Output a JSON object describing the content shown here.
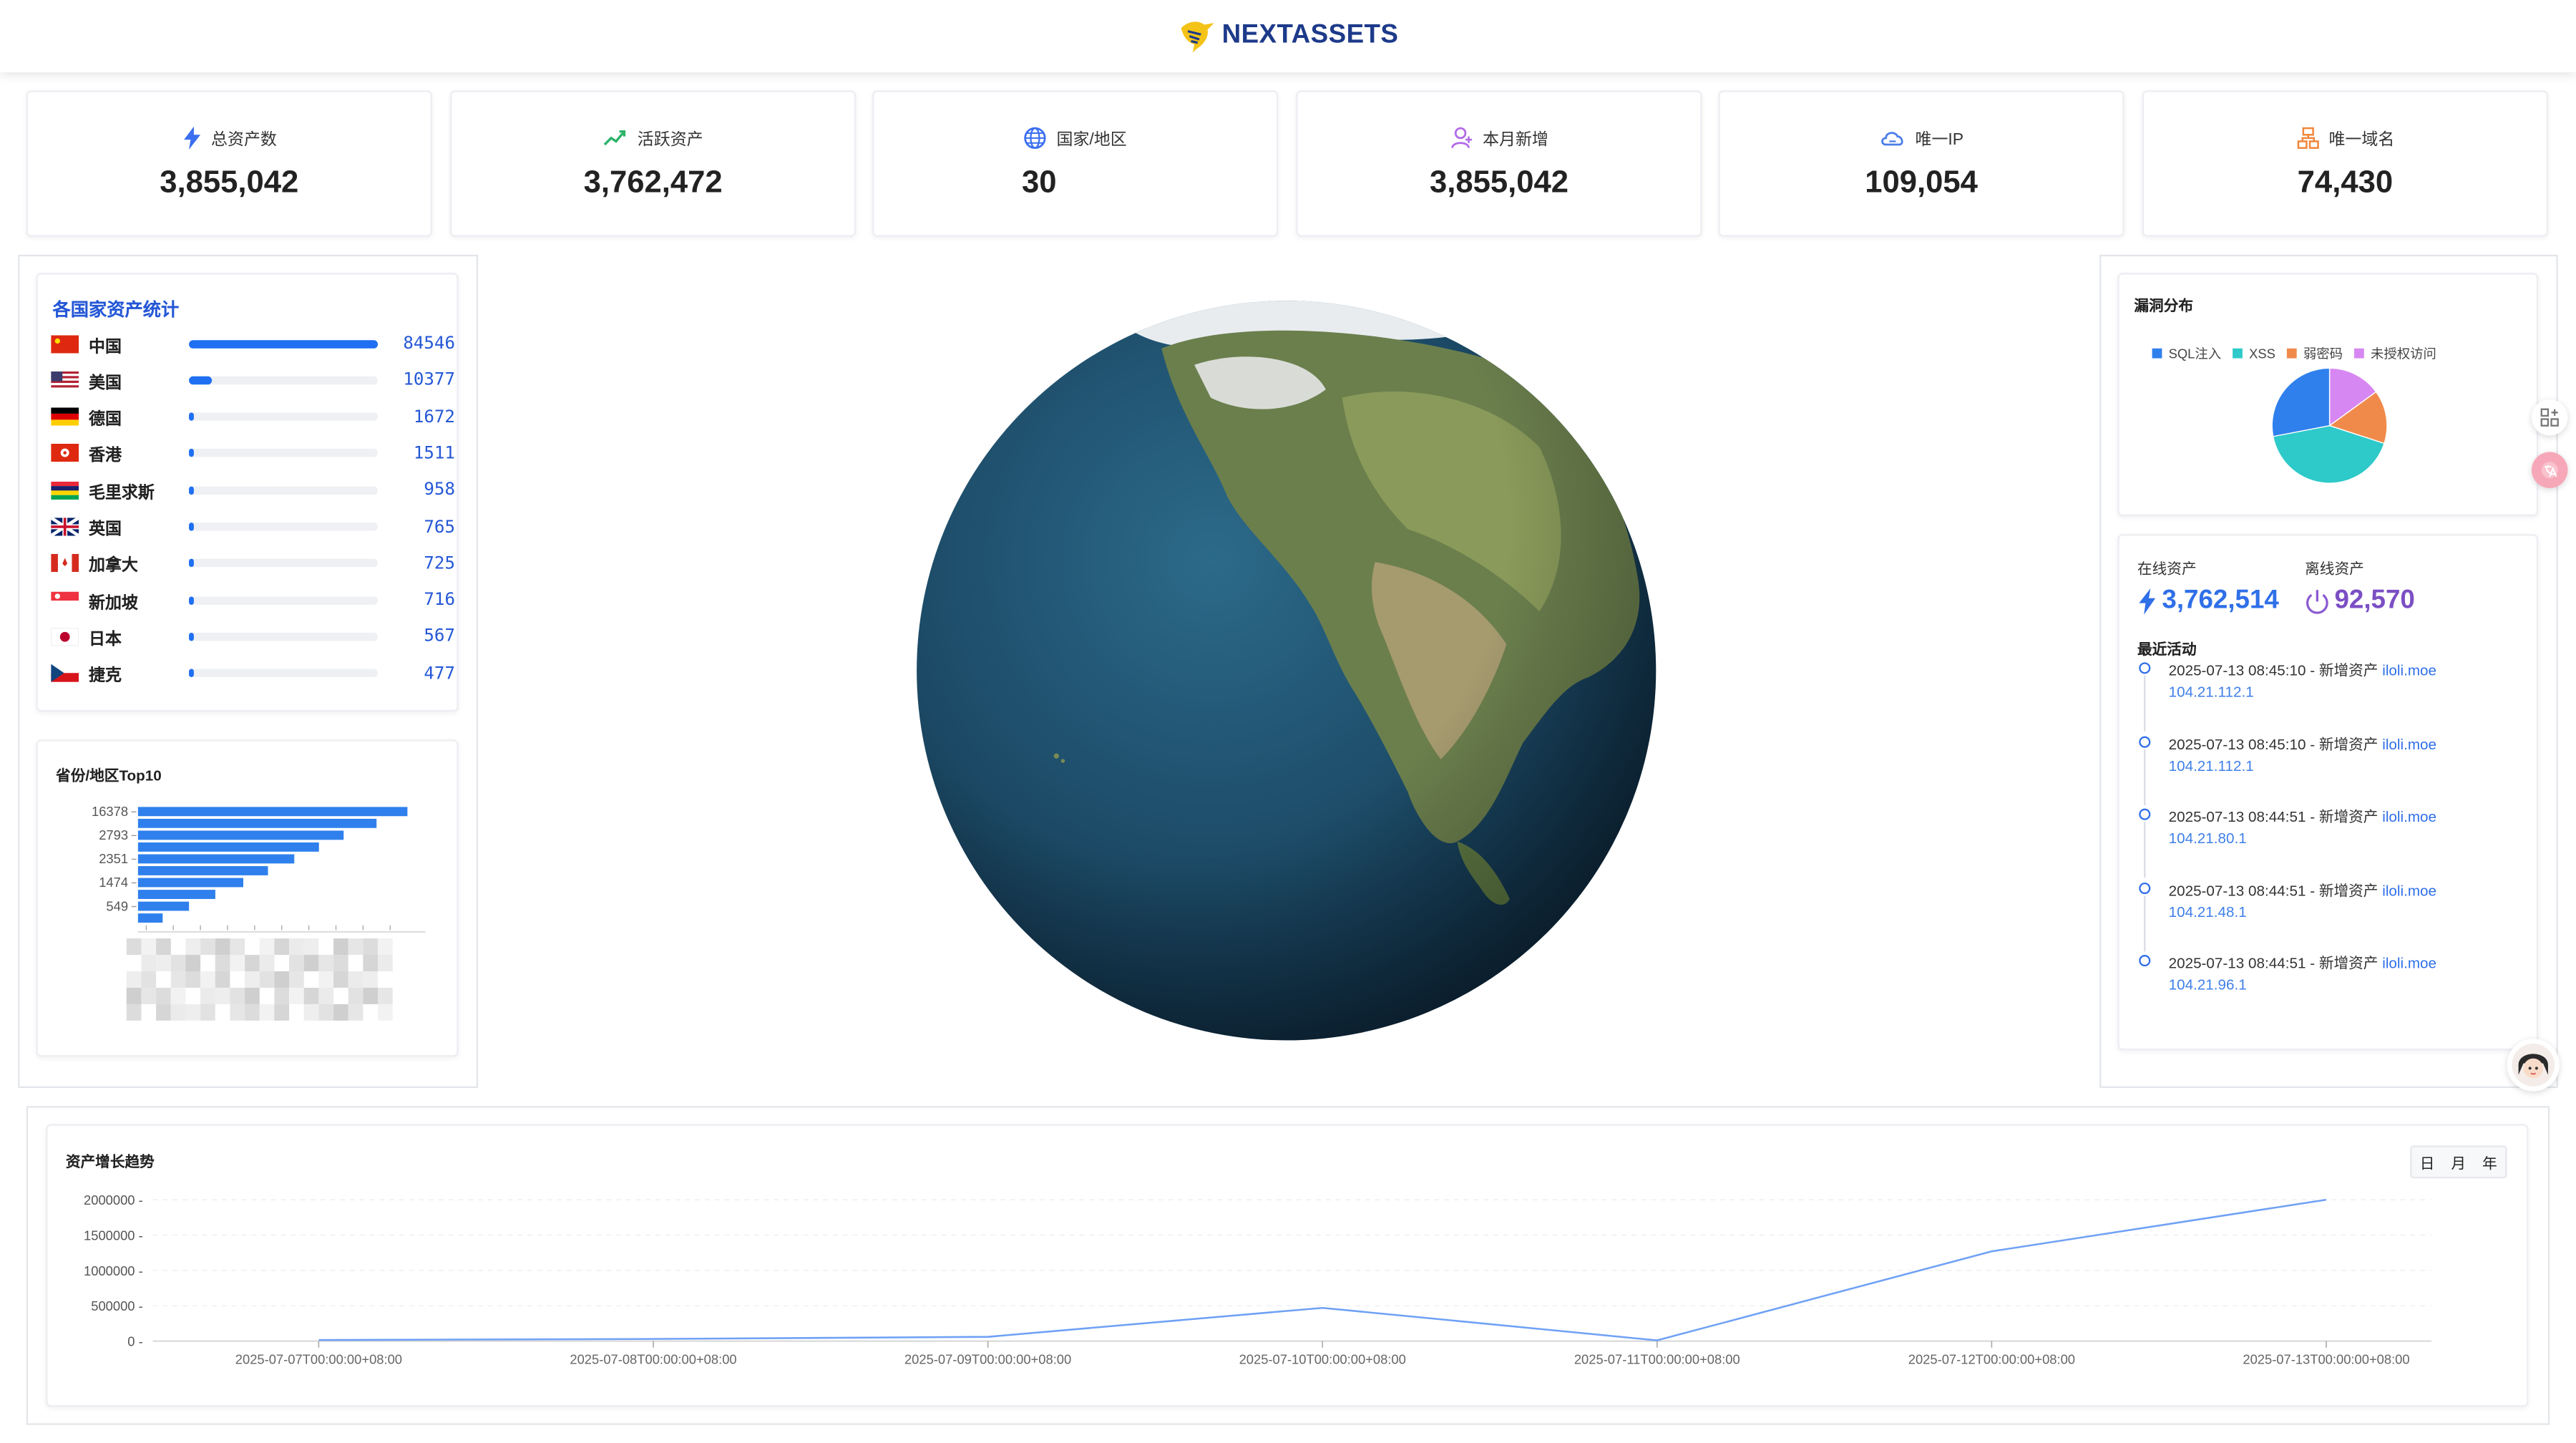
{
  "app": {
    "brand": "NEXTASSETS"
  },
  "stats": [
    {
      "label": "总资产数",
      "value": "3,855,042",
      "icon": "bolt-icon"
    },
    {
      "label": "活跃资产",
      "value": "3,762,472",
      "icon": "trend-up-icon"
    },
    {
      "label": "国家/地区",
      "value": "30",
      "icon": "globe-icon"
    },
    {
      "label": "本月新增",
      "value": "3,855,042",
      "icon": "user-add-icon"
    },
    {
      "label": "唯一IP",
      "value": "109,054",
      "icon": "cloud-icon"
    },
    {
      "label": "唯一域名",
      "value": "74,430",
      "icon": "sitemap-icon"
    }
  ],
  "countries": {
    "title": "各国家资产统计",
    "items": [
      {
        "name": "中国",
        "value": "84546",
        "ratio": 1.0
      },
      {
        "name": "美国",
        "value": "10377",
        "ratio": 0.123
      },
      {
        "name": "德国",
        "value": "1672",
        "ratio": 0.02
      },
      {
        "name": "香港",
        "value": "1511",
        "ratio": 0.018
      },
      {
        "name": "毛里求斯",
        "value": "958",
        "ratio": 0.011
      },
      {
        "name": "英国",
        "value": "765",
        "ratio": 0.009
      },
      {
        "name": "加拿大",
        "value": "725",
        "ratio": 0.009
      },
      {
        "name": "新加坡",
        "value": "716",
        "ratio": 0.008
      },
      {
        "name": "日本",
        "value": "567",
        "ratio": 0.007
      },
      {
        "name": "捷克",
        "value": "477",
        "ratio": 0.006
      }
    ]
  },
  "province": {
    "title": "省份/地区Top10",
    "chart_data": {
      "type": "bar",
      "orientation": "horizontal",
      "tick_labels": [
        "16378",
        "2793",
        "2351",
        "1474",
        "549"
      ],
      "values": [
        16378,
        14500,
        12500,
        11000,
        9500,
        7900,
        6400,
        4700,
        3100,
        1500
      ]
    }
  },
  "vuln": {
    "title": "漏洞分布",
    "chart_data": {
      "type": "pie",
      "legend": [
        "SQL注入",
        "XSS",
        "弱密码",
        "未授权访问"
      ],
      "values": [
        28,
        42,
        15,
        15
      ],
      "colors": [
        "#2f80ed",
        "#2ec9c9",
        "#f08a4b",
        "#d787f2"
      ]
    }
  },
  "status": {
    "online_label": "在线资产",
    "online_value": "3,762,514",
    "offline_label": "离线资产",
    "offline_value": "92,570",
    "activity_title": "最近活动",
    "activities": [
      {
        "text": "2025-07-13 08:45:10 - 新增资产 ",
        "domain": "iloli.moe",
        "ip": "104.21.112.1"
      },
      {
        "text": "2025-07-13 08:45:10 - 新增资产 ",
        "domain": "iloli.moe",
        "ip": "104.21.112.1"
      },
      {
        "text": "2025-07-13 08:44:51 - 新增资产 ",
        "domain": "iloli.moe",
        "ip": "104.21.80.1"
      },
      {
        "text": "2025-07-13 08:44:51 - 新增资产 ",
        "domain": "iloli.moe",
        "ip": "104.21.48.1"
      },
      {
        "text": "2025-07-13 08:44:51 - 新增资产 ",
        "domain": "iloli.moe",
        "ip": "104.21.96.1"
      }
    ]
  },
  "trend": {
    "title": "资产增长趋势",
    "ranges": [
      "日",
      "月",
      "年"
    ],
    "chart_data": {
      "type": "line",
      "x": [
        "2025-07-07T00:00:00+08:00",
        "2025-07-08T00:00:00+08:00",
        "2025-07-09T00:00:00+08:00",
        "2025-07-10T00:00:00+08:00",
        "2025-07-11T00:00:00+08:00",
        "2025-07-12T00:00:00+08:00",
        "2025-07-13T00:00:00+08:00"
      ],
      "y": [
        15000,
        30000,
        60000,
        470000,
        10000,
        1270000,
        2000000
      ],
      "yticks": [
        "2000000",
        "1500000",
        "1000000",
        "500000",
        "0"
      ],
      "ylim": [
        0,
        2000000
      ],
      "color": "#6fa1f5"
    }
  }
}
